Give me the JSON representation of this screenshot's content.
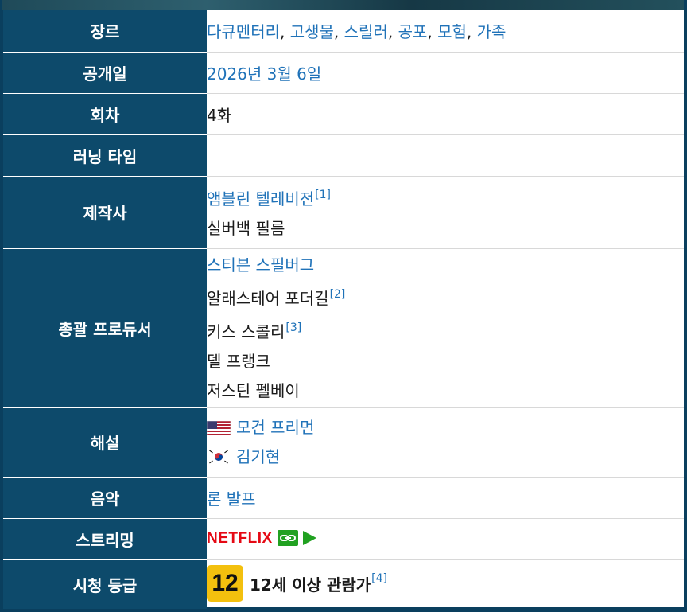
{
  "rows": {
    "genre": {
      "header": "장르",
      "items": [
        "다큐멘터리",
        "고생물",
        "스릴러",
        "공포",
        "모험",
        "가족"
      ],
      "separator": ", "
    },
    "release": {
      "header": "공개일",
      "value": "2026년 3월 6일"
    },
    "episodes": {
      "header": "회차",
      "value": "4화"
    },
    "runtime": {
      "header": "러닝 타임",
      "value": ""
    },
    "production": {
      "header": "제작사",
      "items": [
        {
          "name": "앰블린 텔레비전",
          "ref": "[1]",
          "link": true
        },
        {
          "name": "실버백 필름",
          "ref": "",
          "link": false
        }
      ]
    },
    "executive_producers": {
      "header": "총괄 프로듀서",
      "items": [
        {
          "name": "스티븐 스필버그",
          "ref": "",
          "link": true
        },
        {
          "name": "알래스테어 포더길",
          "ref": "[2]",
          "link": false
        },
        {
          "name": "키스 스콜리",
          "ref": "[3]",
          "link": false
        },
        {
          "name": "델 프랭크",
          "ref": "",
          "link": false
        },
        {
          "name": "저스틴 펠베이",
          "ref": "",
          "link": false
        }
      ]
    },
    "narration": {
      "header": "해설",
      "items": [
        {
          "flag": "us-flag-icon",
          "name": "모건 프리먼"
        },
        {
          "flag": "kr-flag-icon",
          "name": "김기현"
        }
      ]
    },
    "music": {
      "header": "음악",
      "value": "론 발프"
    },
    "streaming": {
      "header": "스트리밍",
      "service": "NETFLIX",
      "link_icon": "link-icon",
      "play_icon": "play-icon"
    },
    "rating": {
      "header": "시청 등급",
      "badge": "12",
      "label": "12세 이상 관람가",
      "ref": "[4]"
    }
  },
  "colors": {
    "header_bg": "#0d4a6b",
    "link": "#1f72b8",
    "netflix_red": "#e50914",
    "rating_yellow": "#f3c00e",
    "icon_green": "#21a121"
  }
}
